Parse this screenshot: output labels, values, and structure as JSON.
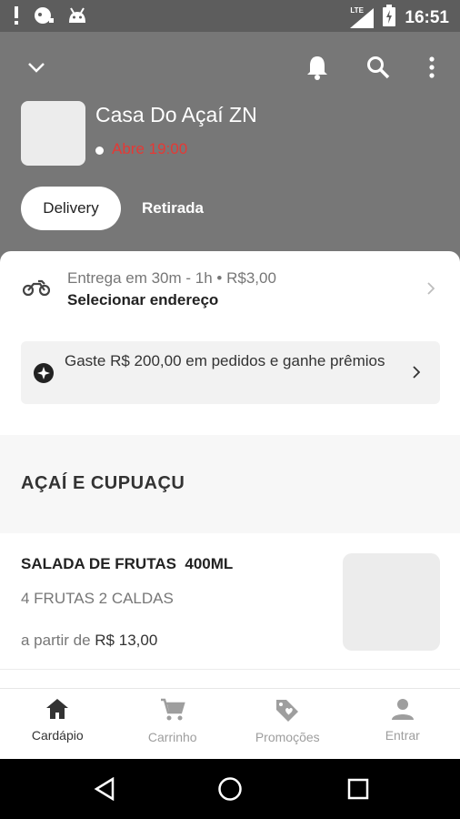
{
  "status_bar": {
    "time": "16:51",
    "network_label": "LTE",
    "icons": [
      "alert-icon",
      "notification-icon",
      "android-icon",
      "signal-icon",
      "battery-icon"
    ]
  },
  "header": {
    "store_name": "Casa Do Açaí ZN",
    "open_status": "Abre 19:00",
    "tabs": [
      {
        "label": "Delivery",
        "selected": true
      },
      {
        "label": "Retirada",
        "selected": false
      }
    ],
    "icons": [
      "chevron-down-icon",
      "bell-icon",
      "search-icon",
      "more-vert-icon"
    ],
    "colors": {
      "header_bg": "#777777",
      "open_status": "#e53935"
    }
  },
  "delivery": {
    "info": "Entrega em 30m - 1h • R$3,00",
    "address_label": "Selecionar endereço"
  },
  "promo": {
    "text": "Gaste R$ 200,00 em pedidos e ganhe prêmios"
  },
  "menu": {
    "section_title": "AÇAÍ E CUPUAÇU",
    "products": [
      {
        "name": "SALADA DE FRUTAS  400ML",
        "description": "4 FRUTAS 2 CALDAS",
        "price_prefix": "a partir de",
        "price": "R$ 13,00"
      }
    ]
  },
  "bottom_nav": {
    "items": [
      {
        "label": "Cardápio",
        "icon": "home-icon",
        "active": true
      },
      {
        "label": "Carrinho",
        "icon": "cart-icon",
        "active": false
      },
      {
        "label": "Promoções",
        "icon": "tag-icon",
        "active": false
      },
      {
        "label": "Entrar",
        "icon": "person-icon",
        "active": false
      }
    ]
  },
  "system_nav": {
    "icons": [
      "back-icon",
      "home-circle-icon",
      "recents-icon"
    ]
  }
}
